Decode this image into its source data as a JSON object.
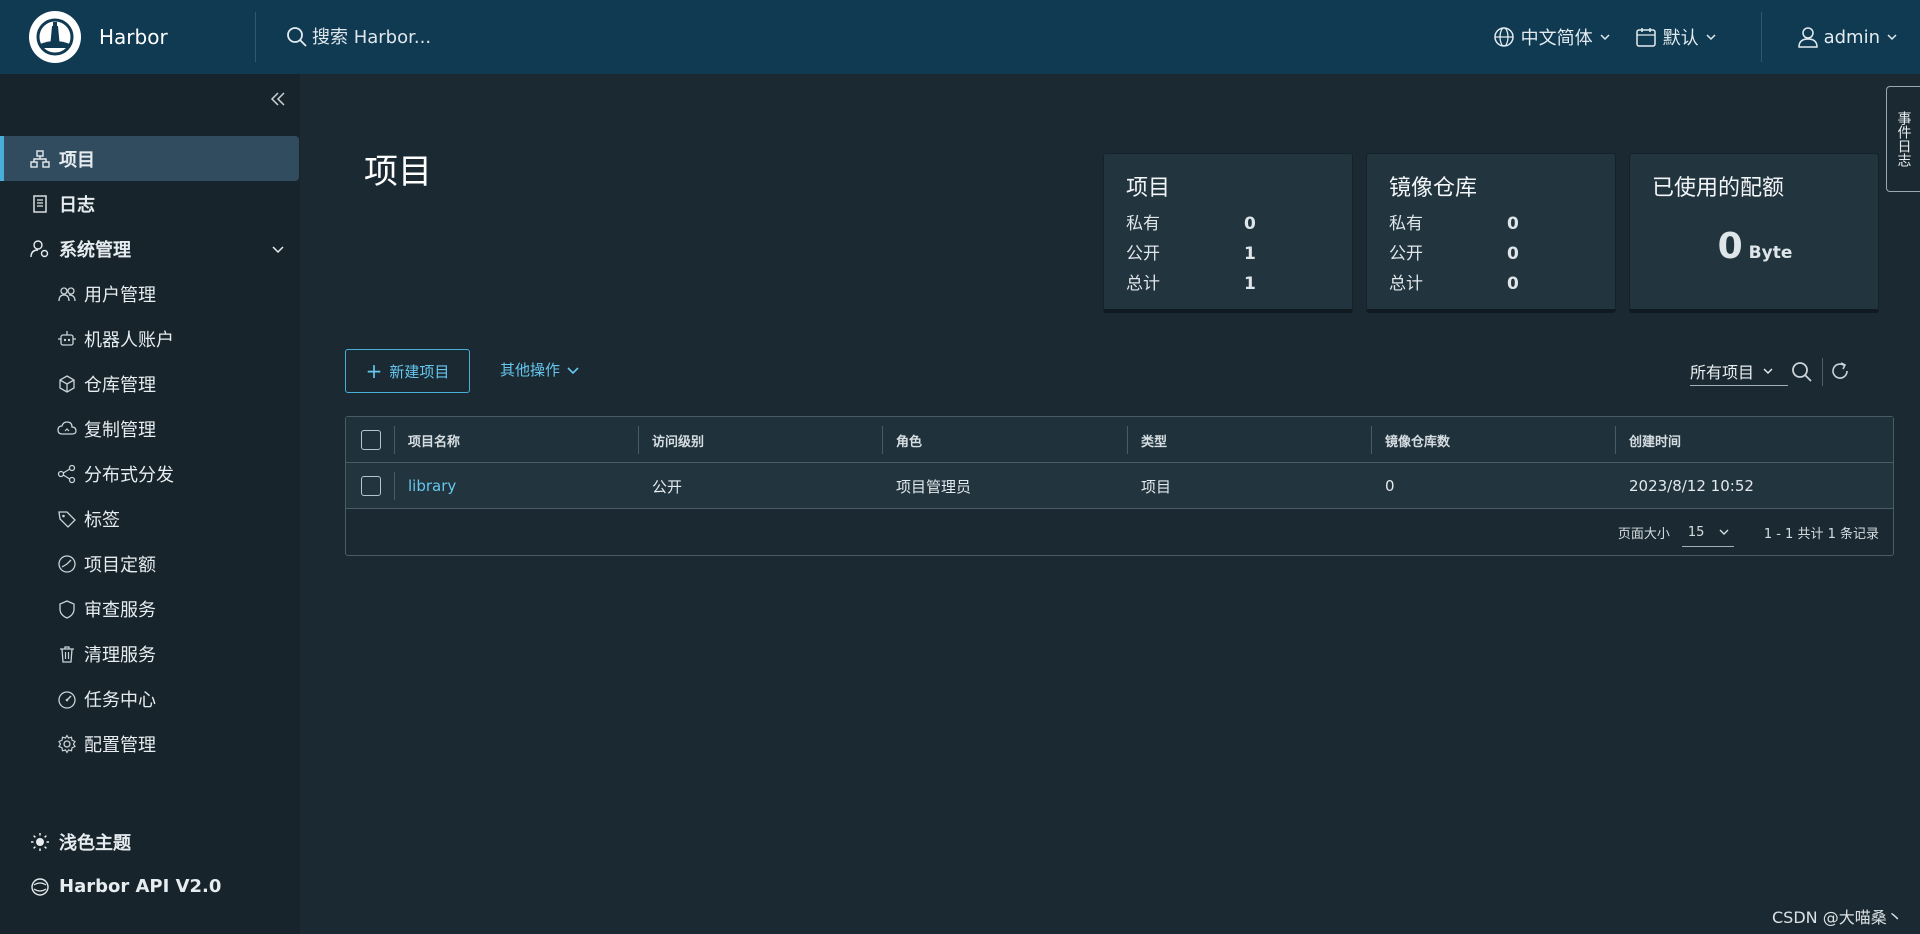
{
  "header": {
    "brand": "Harbor",
    "search_placeholder": "搜索 Harbor...",
    "language": "中文简体",
    "date_format": "默认",
    "user": "admin"
  },
  "sidebar": {
    "items": [
      {
        "label": "项目",
        "icon": "projects-icon",
        "active": true
      },
      {
        "label": "日志",
        "icon": "logs-icon"
      },
      {
        "label": "系统管理",
        "icon": "admin-icon",
        "expanded": true
      }
    ],
    "sub_items": [
      {
        "label": "用户管理",
        "icon": "users-icon"
      },
      {
        "label": "机器人账户",
        "icon": "robot-icon"
      },
      {
        "label": "仓库管理",
        "icon": "registry-icon"
      },
      {
        "label": "复制管理",
        "icon": "replication-icon"
      },
      {
        "label": "分布式分发",
        "icon": "distribution-icon"
      },
      {
        "label": "标签",
        "icon": "tag-icon"
      },
      {
        "label": "项目定额",
        "icon": "quota-icon"
      },
      {
        "label": "审查服务",
        "icon": "shield-icon"
      },
      {
        "label": "清理服务",
        "icon": "trash-icon"
      },
      {
        "label": "任务中心",
        "icon": "dashboard-icon"
      },
      {
        "label": "配置管理",
        "icon": "gear-icon"
      }
    ],
    "bottom": {
      "theme": "浅色主题",
      "api": "Harbor API V2.0"
    }
  },
  "page": {
    "title": "项目"
  },
  "cards": {
    "projects": {
      "title": "项目",
      "rows": [
        {
          "label": "私有",
          "value": "0"
        },
        {
          "label": "公开",
          "value": "1"
        },
        {
          "label": "总计",
          "value": "1"
        }
      ]
    },
    "repos": {
      "title": "镜像仓库",
      "rows": [
        {
          "label": "私有",
          "value": "0"
        },
        {
          "label": "公开",
          "value": "0"
        },
        {
          "label": "总计",
          "value": "0"
        }
      ]
    },
    "quota": {
      "title": "已使用的配额",
      "value": "0",
      "unit": "Byte"
    }
  },
  "toolbar": {
    "new_project": "新建项目",
    "other_ops": "其他操作",
    "filter": "所有项目"
  },
  "table": {
    "columns": [
      "项目名称",
      "访问级别",
      "角色",
      "类型",
      "镜像仓库数",
      "创建时间"
    ],
    "rows": [
      {
        "name": "library",
        "access": "公开",
        "role": "项目管理员",
        "type": "项目",
        "repo_count": "0",
        "created": "2023/8/12 10:52"
      }
    ],
    "footer": {
      "page_size_label": "页面大小",
      "page_size": "15",
      "total": "1 - 1 共计 1 条记录"
    }
  },
  "side_tab": "事件日志",
  "watermark": "CSDN @大喵桑丶"
}
